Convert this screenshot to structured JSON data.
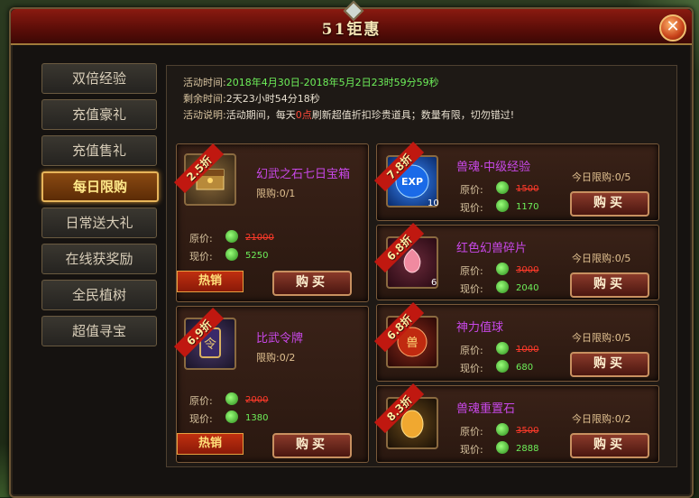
{
  "window": {
    "title": "51钜惠",
    "close_glyph": "✕"
  },
  "sidebar": {
    "items": [
      {
        "label": "双倍经验"
      },
      {
        "label": "充值豪礼"
      },
      {
        "label": "充值售礼"
      },
      {
        "label": "每日限购"
      },
      {
        "label": "日常送大礼"
      },
      {
        "label": "在线获奖励"
      },
      {
        "label": "全民植树"
      },
      {
        "label": "超值寻宝"
      }
    ],
    "active_index": 3
  },
  "info": {
    "time_label": "活动时间:",
    "time_value": "2018年4月30日-2018年5月2日23时59分59秒",
    "remain_label": "剩余时间:",
    "remain_value": "2天23小时54分18秒",
    "desc_label": "活动说明:",
    "desc_pre": "活动期间，每天",
    "desc_highlight": "0点",
    "desc_post": "刷新超值折扣珍贵道具；数量有限，切勿错过!"
  },
  "labels": {
    "orig": "原价:",
    "now": "现价:",
    "buy": "购买",
    "hot": "热销"
  },
  "big_items": [
    {
      "discount": "2.5折",
      "name": "幻武之石七日宝箱",
      "limit": "限购:0/1",
      "orig_price": "21000",
      "now_price": "5250"
    },
    {
      "discount": "6.9折",
      "name": "比武令牌",
      "limit": "限购:0/2",
      "orig_price": "2000",
      "now_price": "1380"
    }
  ],
  "small_items": [
    {
      "discount": "7.8折",
      "name": "兽魂·中级经验",
      "limit": "今日限购:0/5",
      "orig_price": "1500",
      "now_price": "1170",
      "count": "10"
    },
    {
      "discount": "6.8折",
      "name": "红色幻兽碎片",
      "limit": "今日限购:0/5",
      "orig_price": "3000",
      "now_price": "2040",
      "count": "6"
    },
    {
      "discount": "6.8折",
      "name": "神力值球",
      "limit": "今日限购:0/5",
      "orig_price": "1000",
      "now_price": "680",
      "count": ""
    },
    {
      "discount": "8.3折",
      "name": "兽魂重置石",
      "limit": "今日限购:0/2",
      "orig_price": "3500",
      "now_price": "2888",
      "count": ""
    }
  ]
}
